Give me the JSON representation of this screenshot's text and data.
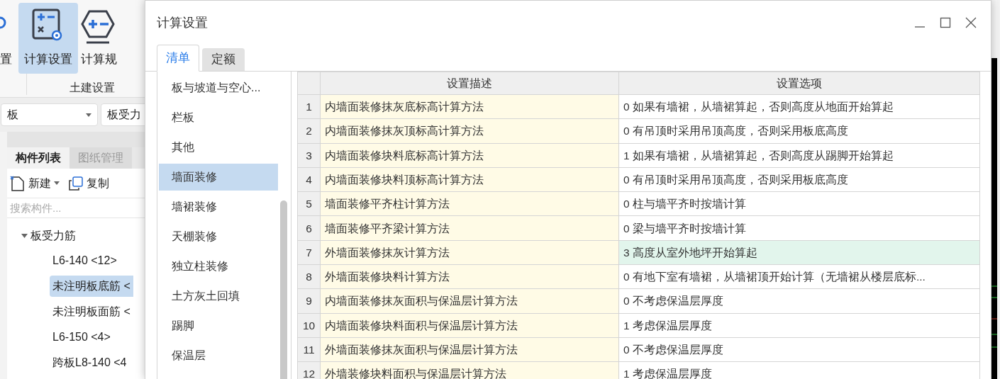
{
  "app": {
    "ribbon": {
      "buttons": [
        {
          "label": "置",
          "kind": "gear",
          "selected": false
        },
        {
          "label": "计算设置",
          "kind": "calc",
          "selected": true
        },
        {
          "label": "计算规",
          "kind": "hex",
          "selected": false
        }
      ],
      "group_label": "土建设置"
    },
    "selectors": [
      {
        "value": "板",
        "dropdown": true
      },
      {
        "value": "板受力",
        "dropdown": false
      }
    ],
    "panel_tabs": [
      {
        "label": "构件列表",
        "selected": true
      },
      {
        "label": "图纸管理",
        "selected": false
      }
    ],
    "toolbar": [
      {
        "label": "新建",
        "kind": "new",
        "dropdown": true
      },
      {
        "label": "复制",
        "kind": "copy",
        "dropdown": false
      }
    ],
    "search": {
      "placeholder": "搜索构件..."
    },
    "tree": [
      {
        "label": "板受力筋",
        "expanded": true,
        "children": [
          {
            "label": "L6-140 <12>",
            "selected": false
          },
          {
            "label": "未注明板底筋 <",
            "selected": true
          },
          {
            "label": "未注明板面筋 <",
            "selected": false
          },
          {
            "label": "L6-150 <4>",
            "selected": false
          },
          {
            "label": "跨板L8-140 <4",
            "selected": false
          }
        ]
      }
    ]
  },
  "dialog": {
    "title": "计算设置",
    "tabs": [
      {
        "label": "清单",
        "selected": true
      },
      {
        "label": "定额",
        "selected": false
      }
    ],
    "categories": [
      {
        "label": "板与坡道与空心...",
        "selected": false
      },
      {
        "label": "栏板",
        "selected": false
      },
      {
        "label": "其他",
        "selected": false
      },
      {
        "label": "墙面装修",
        "selected": true
      },
      {
        "label": "墙裙装修",
        "selected": false
      },
      {
        "label": "天棚装修",
        "selected": false
      },
      {
        "label": "独立柱装修",
        "selected": false
      },
      {
        "label": "土方灰土回填",
        "selected": false
      },
      {
        "label": "踢脚",
        "selected": false
      },
      {
        "label": "保温层",
        "selected": false
      }
    ],
    "table": {
      "columns": [
        "设置描述",
        "设置选项"
      ],
      "rows": [
        {
          "index": "1",
          "description": "内墙面装修抹灰底标高计算方法",
          "option": "0 如果有墙裙，从墙裙算起，否则高度从地面开始算起",
          "selected": false
        },
        {
          "index": "2",
          "description": "内墙面装修抹灰顶标高计算方法",
          "option": "0 有吊顶时采用吊顶高度，否则采用板底高度",
          "selected": false
        },
        {
          "index": "3",
          "description": "内墙面装修块料底标高计算方法",
          "option": "1 如果有墙裙，从墙裙算起，否则高度从踢脚开始算起",
          "selected": false
        },
        {
          "index": "4",
          "description": "内墙面装修块料顶标高计算方法",
          "option": "0 有吊顶时采用吊顶高度，否则采用板底高度",
          "selected": false
        },
        {
          "index": "5",
          "description": "墙面装修平齐柱计算方法",
          "option": "0 柱与墙平齐时按墙计算",
          "selected": false
        },
        {
          "index": "6",
          "description": "墙面装修平齐梁计算方法",
          "option": "0 梁与墙平齐时按墙计算",
          "selected": false
        },
        {
          "index": "7",
          "description": "外墙面装修抹灰计算方法",
          "option": "3 高度从室外地坪开始算起",
          "selected": true
        },
        {
          "index": "8",
          "description": "外墙面装修块料计算方法",
          "option": "0 有地下室有墙裙，从墙裙顶开始计算（无墙裙从楼层底标...",
          "selected": false
        },
        {
          "index": "9",
          "description": "内墙面装修抹灰面积与保温层计算方法",
          "option": "0 不考虑保温层厚度",
          "selected": false
        },
        {
          "index": "10",
          "description": "内墙面装修块料面积与保温层计算方法",
          "option": "1 考虑保温层厚度",
          "selected": false
        },
        {
          "index": "11",
          "description": "外墙面装修抹灰面积与保温层计算方法",
          "option": "0 不考虑保温层厚度",
          "selected": false
        },
        {
          "index": "12",
          "description": "外墙装修块料面积与保温层计算方法",
          "option": "1 考虑保温层厚度",
          "selected": false
        }
      ]
    }
  }
}
